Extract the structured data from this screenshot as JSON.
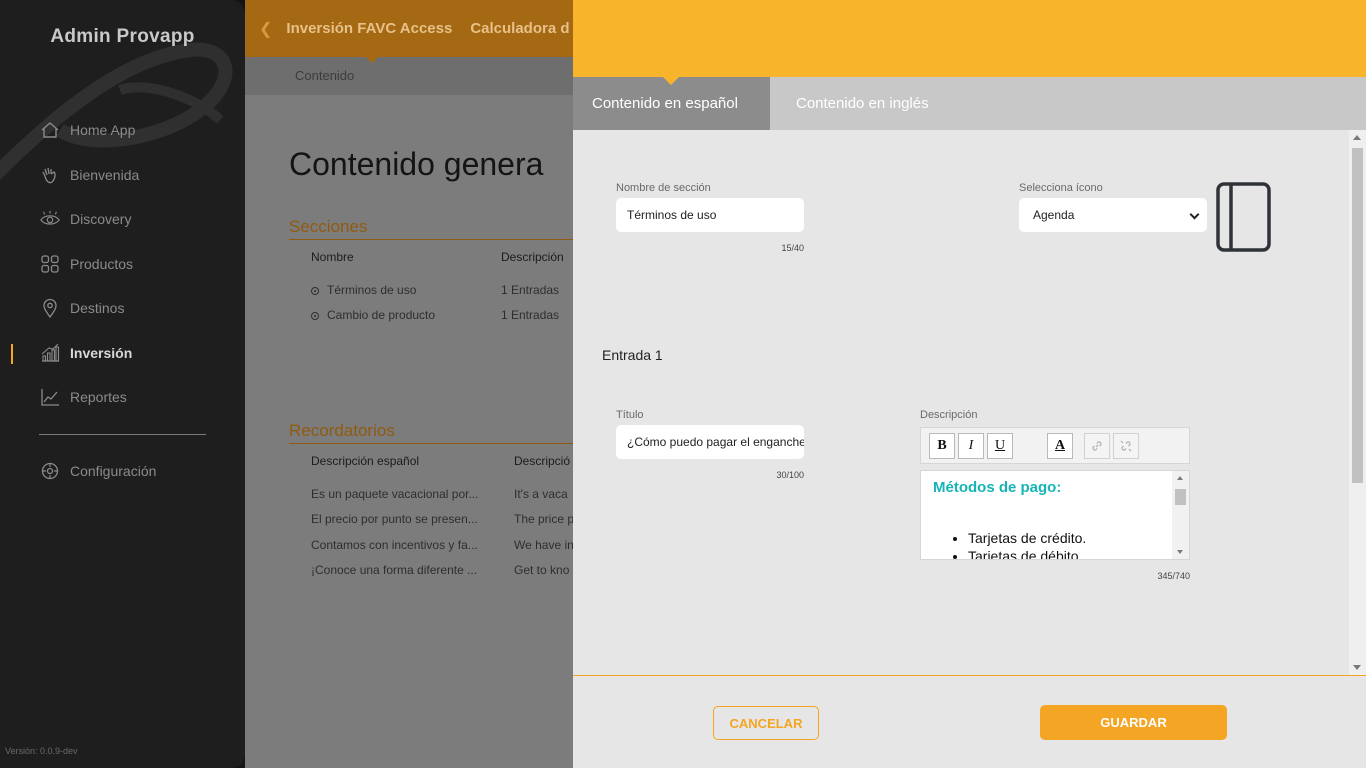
{
  "sidebar": {
    "app_title": "Admin Provapp",
    "version": "Versión: 0.0.9-dev",
    "items": [
      {
        "label": "Home App"
      },
      {
        "label": "Bienvenida"
      },
      {
        "label": "Discovery"
      },
      {
        "label": "Productos"
      },
      {
        "label": "Destinos"
      },
      {
        "label": "Inversión"
      },
      {
        "label": "Reportes"
      }
    ],
    "settings_label": "Configuración"
  },
  "main": {
    "breadcrumbs": [
      "Inversión FAVC Access",
      "Calculadora d"
    ],
    "subnav": "Contenido",
    "page_title": "Contenido genera",
    "sections": {
      "title": "Secciones",
      "columns": [
        "Nombre",
        "Descripción"
      ],
      "rows": [
        {
          "name": "Términos de uso",
          "desc": "1 Entradas"
        },
        {
          "name": "Cambio de producto",
          "desc": "1 Entradas"
        }
      ]
    },
    "reminders": {
      "title": "Recordatorios",
      "columns": [
        "Descripción español",
        "Descripció"
      ],
      "rows": [
        {
          "es": "Es un paquete vacacional por...",
          "en": "It's a vaca"
        },
        {
          "es": "El precio por punto se presen...",
          "en": "The price p"
        },
        {
          "es": "Contamos con incentivos y fa...",
          "en": "We have in"
        },
        {
          "es": "¡Conoce una forma diferente ...",
          "en": "Get to kno"
        }
      ]
    }
  },
  "drawer": {
    "tabs": [
      {
        "label": "Contenido en español"
      },
      {
        "label": "Contenido en inglés"
      }
    ],
    "section_name": {
      "label": "Nombre de sección",
      "value": "Términos de uso",
      "counter": "15/40"
    },
    "icon_select": {
      "label": "Selecciona ícono",
      "value": "Agenda",
      "icon": "agenda-icon"
    },
    "entry_title": "Entrada 1",
    "title_field": {
      "label": "Título",
      "value": "¿Cómo puedo pagar el enganche?",
      "counter": "30/100"
    },
    "description": {
      "label": "Descripción",
      "toolbar": {
        "bold": "B",
        "italic": "I",
        "underline": "U",
        "color": "A"
      },
      "heading": "Métodos de pago:",
      "items": [
        "Tarjetas de crédito.",
        "Tarjetas de débito."
      ],
      "counter": "345/740"
    },
    "cancel_label": "CANCELAR",
    "save_label": "GUARDAR"
  },
  "colors": {
    "accent": "#f5a524",
    "header": "#f8b52b",
    "teal": "#17b4b6"
  }
}
